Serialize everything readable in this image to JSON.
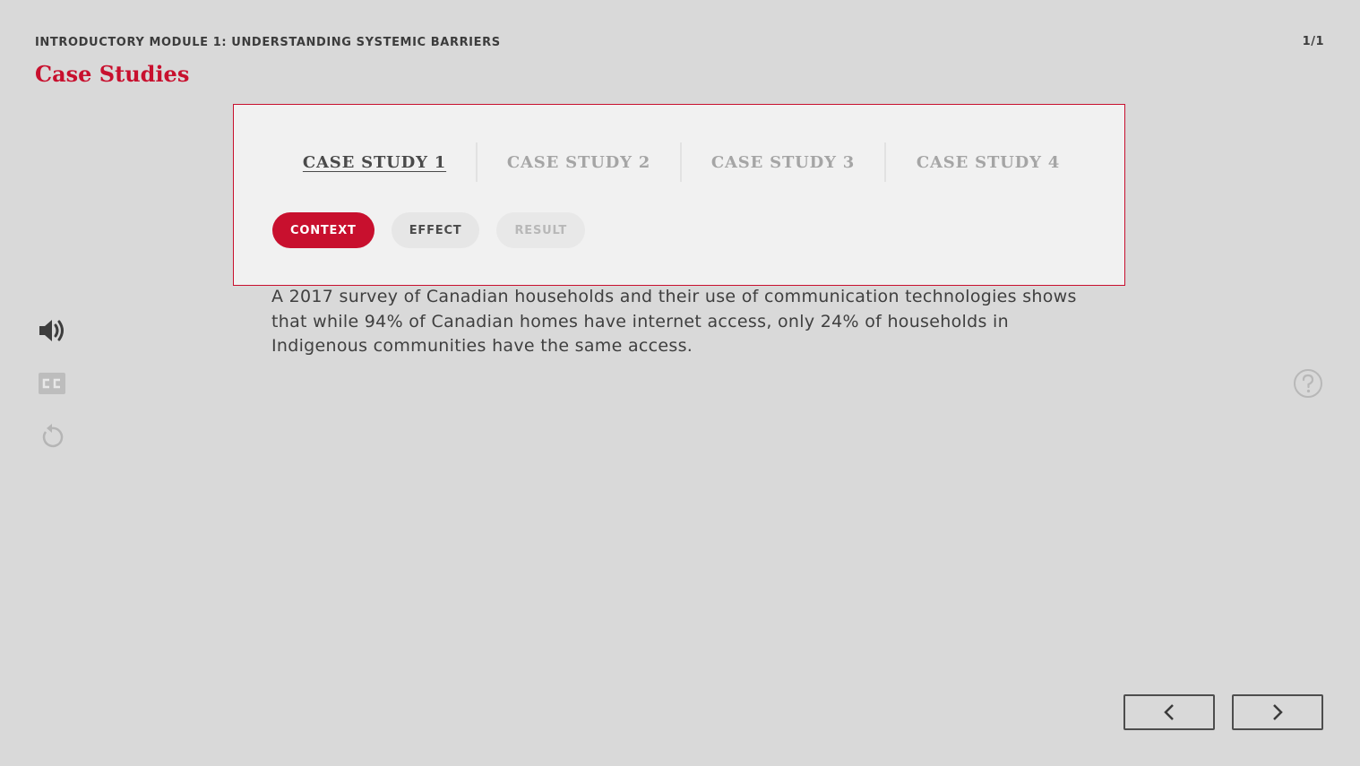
{
  "header": {
    "module_title": "INTRODUCTORY MODULE 1: UNDERSTANDING SYSTEMIC BARRIERS",
    "page_counter": "1/1",
    "page_title": "Case Studies"
  },
  "case_tabs": [
    {
      "label": "CASE STUDY 1",
      "active": true
    },
    {
      "label": "CASE STUDY 2",
      "active": false
    },
    {
      "label": "CASE STUDY 3",
      "active": false
    },
    {
      "label": "CASE STUDY 4",
      "active": false
    }
  ],
  "section_pills": [
    {
      "label": "CONTEXT",
      "state": "active"
    },
    {
      "label": "EFFECT",
      "state": "default"
    },
    {
      "label": "RESULT",
      "state": "disabled"
    }
  ],
  "content": {
    "body": "A 2017 survey of Canadian households and their use of communication technologies shows that while 94% of Canadian homes have internet access, only 24% of households in Indigenous communities have the same access."
  },
  "controls": {
    "audio_icon": "speaker-icon",
    "captions_icon": "closed-captions-icon",
    "replay_icon": "replay-icon",
    "help_icon": "help-icon",
    "prev_icon": "chevron-left-icon",
    "next_icon": "chevron-right-icon"
  },
  "colors": {
    "accent": "#c8102e",
    "background": "#d9d9d9",
    "panel": "#f1f1f1"
  }
}
